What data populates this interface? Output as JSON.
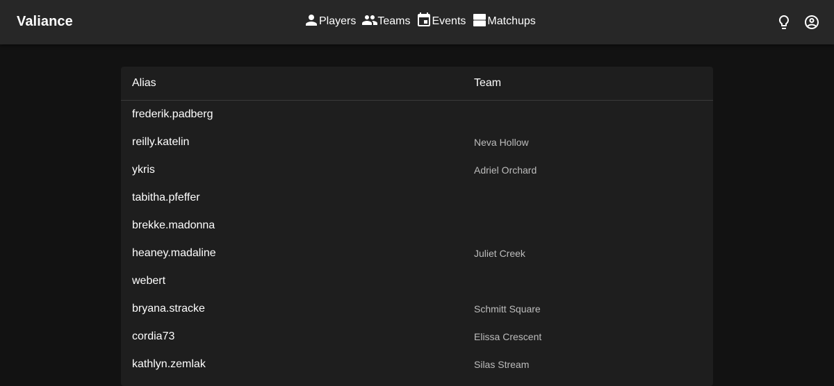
{
  "app": {
    "title": "Valiance"
  },
  "nav": [
    {
      "label": "Players",
      "icon": "person-icon"
    },
    {
      "label": "Teams",
      "icon": "group-icon"
    },
    {
      "label": "Events",
      "icon": "calendar-icon"
    },
    {
      "label": "Matchups",
      "icon": "matchups-icon"
    }
  ],
  "actions": {
    "theme_icon": "lightbulb-icon",
    "account_icon": "account-circle-icon"
  },
  "table": {
    "columns": [
      "Alias",
      "Team"
    ],
    "rows": [
      {
        "alias": "frederik.padberg",
        "team": ""
      },
      {
        "alias": "reilly.katelin",
        "team": "Neva Hollow"
      },
      {
        "alias": "ykris",
        "team": "Adriel Orchard"
      },
      {
        "alias": "tabitha.pfeffer",
        "team": ""
      },
      {
        "alias": "brekke.madonna",
        "team": ""
      },
      {
        "alias": "heaney.madaline",
        "team": "Juliet Creek"
      },
      {
        "alias": "webert",
        "team": ""
      },
      {
        "alias": "bryana.stracke",
        "team": "Schmitt Square"
      },
      {
        "alias": "cordia73",
        "team": "Elissa Crescent"
      },
      {
        "alias": "kathlyn.zemlak",
        "team": "Silas Stream"
      }
    ]
  },
  "colors": {
    "background": "#121212",
    "appbar": "#272727",
    "card": "#1e1e1e",
    "secondary_text": "#bdbdbd"
  }
}
